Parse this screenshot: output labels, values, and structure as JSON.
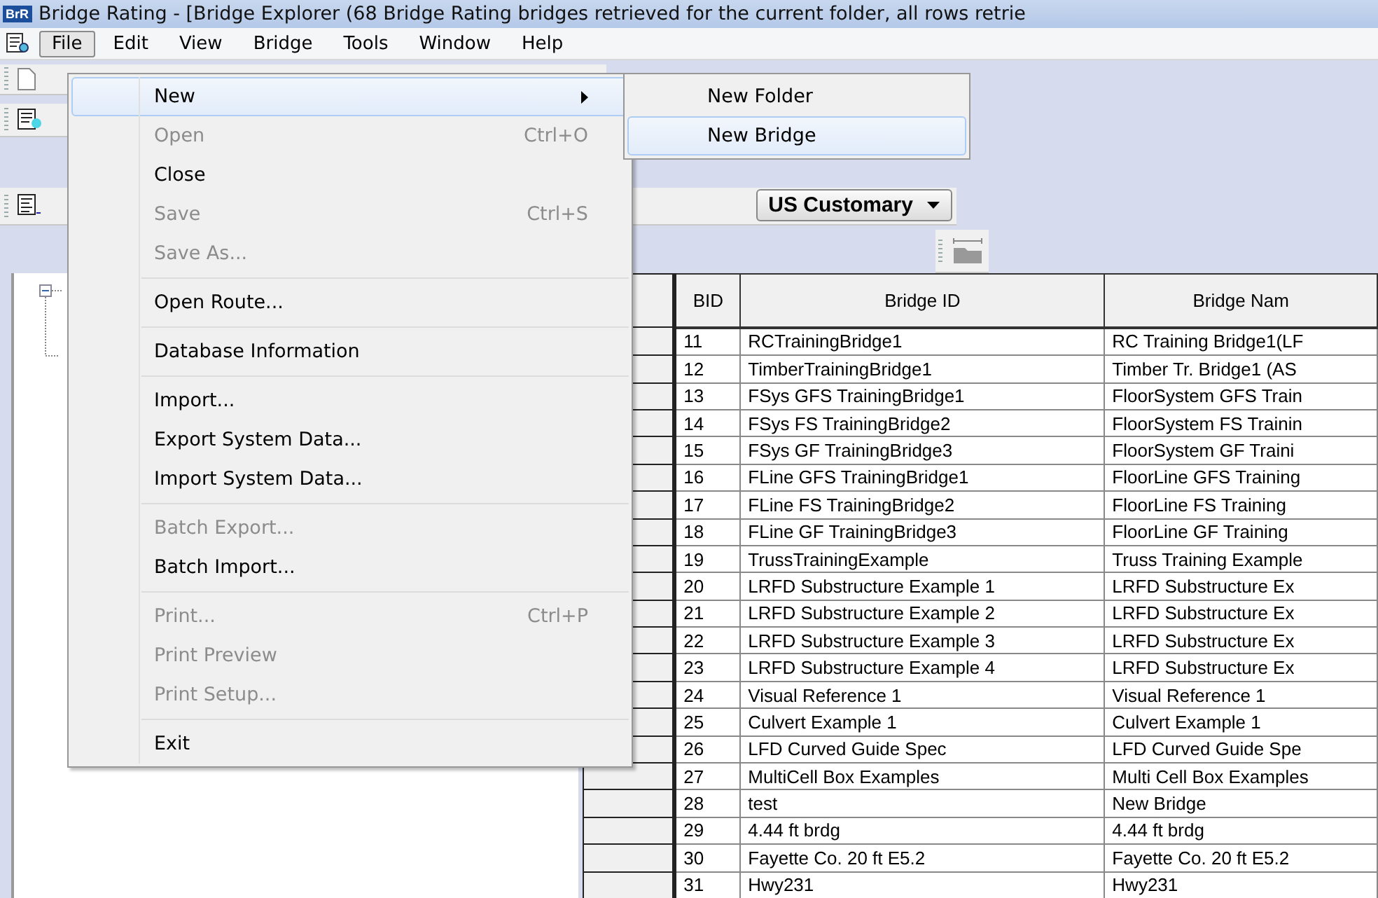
{
  "window": {
    "logo": "BrR",
    "title": "Bridge Rating - [Bridge Explorer (68 Bridge Rating bridges retrieved for the current folder, all rows retrie"
  },
  "menubar": [
    {
      "label": "File",
      "selected": true
    },
    {
      "label": "Edit",
      "selected": false
    },
    {
      "label": "View",
      "selected": false
    },
    {
      "label": "Bridge",
      "selected": false
    },
    {
      "label": "Tools",
      "selected": false
    },
    {
      "label": "Window",
      "selected": false
    },
    {
      "label": "Help",
      "selected": false
    }
  ],
  "file_menu": {
    "groups": [
      [
        {
          "label": "New",
          "has_submenu": true,
          "disabled": false,
          "selected": true
        },
        {
          "label": "Open",
          "shortcut": "Ctrl+O",
          "has_submenu": false,
          "disabled": true,
          "selected": false
        },
        {
          "label": "Close",
          "has_submenu": false,
          "disabled": false,
          "selected": false
        },
        {
          "label": "Save",
          "shortcut": "Ctrl+S",
          "has_submenu": false,
          "disabled": true,
          "selected": false
        },
        {
          "label": "Save As...",
          "has_submenu": false,
          "disabled": true,
          "selected": false
        }
      ],
      [
        {
          "label": "Open Route...",
          "has_submenu": false,
          "disabled": false,
          "selected": false
        }
      ],
      [
        {
          "label": "Database Information",
          "has_submenu": false,
          "disabled": false,
          "selected": false
        }
      ],
      [
        {
          "label": "Import...",
          "has_submenu": false,
          "disabled": false,
          "selected": false
        },
        {
          "label": "Export System Data...",
          "has_submenu": false,
          "disabled": false,
          "selected": false
        },
        {
          "label": "Import System Data...",
          "has_submenu": false,
          "disabled": false,
          "selected": false
        }
      ],
      [
        {
          "label": "Batch Export...",
          "has_submenu": false,
          "disabled": true,
          "selected": false
        },
        {
          "label": "Batch Import...",
          "has_submenu": false,
          "disabled": false,
          "selected": false
        }
      ],
      [
        {
          "label": "Print...",
          "shortcut": "Ctrl+P",
          "has_submenu": false,
          "disabled": true,
          "selected": false
        },
        {
          "label": "Print Preview",
          "has_submenu": false,
          "disabled": true,
          "selected": false
        },
        {
          "label": "Print Setup...",
          "has_submenu": false,
          "disabled": true,
          "selected": false
        }
      ],
      [
        {
          "label": "Exit",
          "has_submenu": false,
          "disabled": false,
          "selected": false
        }
      ]
    ]
  },
  "new_submenu": [
    {
      "label": "New Folder",
      "selected": false
    },
    {
      "label": "New Bridge",
      "selected": true
    }
  ],
  "toolbar": {
    "units": "US Customary"
  },
  "table": {
    "columns": [
      "BID",
      "Bridge ID",
      "Bridge Nam"
    ],
    "rows": [
      [
        "11",
        "RCTrainingBridge1",
        "RC Training Bridge1(LF"
      ],
      [
        "12",
        "TimberTrainingBridge1",
        "Timber Tr. Bridge1 (AS"
      ],
      [
        "13",
        "FSys GFS TrainingBridge1",
        "FloorSystem GFS Train"
      ],
      [
        "14",
        "FSys FS TrainingBridge2",
        "FloorSystem FS Trainin"
      ],
      [
        "15",
        "FSys GF TrainingBridge3",
        "FloorSystem GF Traini"
      ],
      [
        "16",
        "FLine GFS TrainingBridge1",
        "FloorLine GFS Training"
      ],
      [
        "17",
        "FLine FS TrainingBridge2",
        "FloorLine FS Training"
      ],
      [
        "18",
        "FLine GF TrainingBridge3",
        "FloorLine GF Training"
      ],
      [
        "19",
        "TrussTrainingExample",
        "Truss Training Example"
      ],
      [
        "20",
        "LRFD Substructure Example 1",
        "LRFD Substructure Ex"
      ],
      [
        "21",
        "LRFD Substructure Example 2",
        "LRFD Substructure Ex"
      ],
      [
        "22",
        "LRFD Substructure Example 3",
        "LRFD Substructure Ex"
      ],
      [
        "23",
        "LRFD Substructure Example 4",
        "LRFD Substructure Ex"
      ],
      [
        "24",
        "Visual Reference 1",
        "Visual Reference 1"
      ],
      [
        "25",
        "Culvert Example 1",
        "Culvert Example 1"
      ],
      [
        "26",
        "LFD Curved Guide Spec",
        "LFD Curved Guide Spe"
      ],
      [
        "27",
        "MultiCell Box Examples",
        "Multi Cell Box Examples"
      ],
      [
        "28",
        "test",
        "New Bridge"
      ],
      [
        "29",
        "4.44 ft brdg",
        "4.44 ft brdg"
      ],
      [
        "30",
        "Fayette Co. 20 ft E5.2",
        "Fayette Co. 20 ft E5.2"
      ],
      [
        "31",
        "Hwy231",
        "Hwy231"
      ]
    ]
  }
}
